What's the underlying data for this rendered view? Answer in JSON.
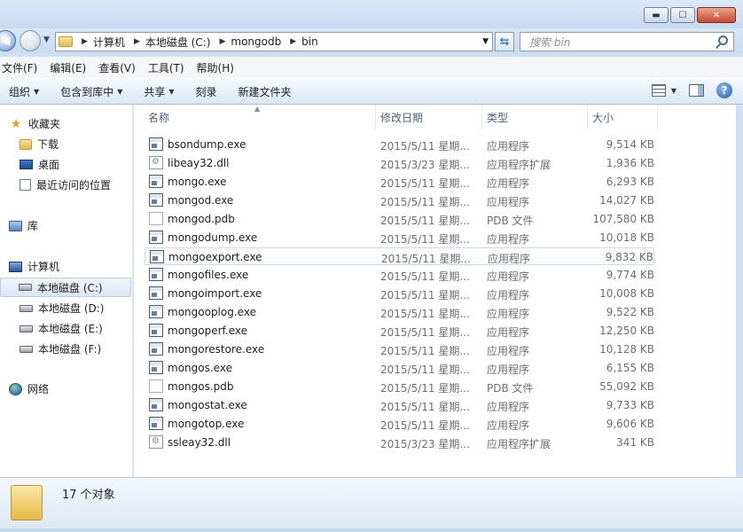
{
  "window": {
    "controls": {
      "minimize": "▬",
      "maximize": "☐",
      "close": "✕"
    }
  },
  "address": {
    "crumbs": [
      "计算机",
      "本地磁盘 (C:)",
      "mongodb",
      "bin"
    ],
    "search_placeholder": "搜索 bin"
  },
  "menu": [
    "文件(F)",
    "编辑(E)",
    "查看(V)",
    "工具(T)",
    "帮助(H)"
  ],
  "commands": [
    "组织",
    "包含到库中",
    "共享",
    "刻录",
    "新建文件夹"
  ],
  "sidebar": {
    "favorites": "收藏夹",
    "fav_items": [
      "下载",
      "桌面",
      "最近访问的位置"
    ],
    "library": "库",
    "computer": "计算机",
    "drives": [
      "本地磁盘 (C:)",
      "本地磁盘 (D:)",
      "本地磁盘 (E:)",
      "本地磁盘 (F:)"
    ],
    "network": "网络"
  },
  "columns": {
    "name": "名称",
    "date": "修改日期",
    "type": "类型",
    "size": "大小"
  },
  "files": [
    {
      "name": "bsondump.exe",
      "date": "2015/5/11 星期...",
      "type": "应用程序",
      "size": "9,514 KB",
      "icon": "exe-icon"
    },
    {
      "name": "libeay32.dll",
      "date": "2015/3/23 星期...",
      "type": "应用程序扩展",
      "size": "1,936 KB",
      "icon": "dll-icon"
    },
    {
      "name": "mongo.exe",
      "date": "2015/5/11 星期...",
      "type": "应用程序",
      "size": "6,293 KB",
      "icon": "exe-icon"
    },
    {
      "name": "mongod.exe",
      "date": "2015/5/11 星期...",
      "type": "应用程序",
      "size": "14,027 KB",
      "icon": "exe-icon"
    },
    {
      "name": "mongod.pdb",
      "date": "2015/5/11 星期...",
      "type": "PDB 文件",
      "size": "107,580 KB",
      "icon": "pdb-icon"
    },
    {
      "name": "mongodump.exe",
      "date": "2015/5/11 星期...",
      "type": "应用程序",
      "size": "10,018 KB",
      "icon": "exe-icon"
    },
    {
      "name": "mongoexport.exe",
      "date": "2015/5/11 星期...",
      "type": "应用程序",
      "size": "9,832 KB",
      "icon": "exe-icon"
    },
    {
      "name": "mongofiles.exe",
      "date": "2015/5/11 星期...",
      "type": "应用程序",
      "size": "9,774 KB",
      "icon": "exe-icon"
    },
    {
      "name": "mongoimport.exe",
      "date": "2015/5/11 星期...",
      "type": "应用程序",
      "size": "10,008 KB",
      "icon": "exe-icon"
    },
    {
      "name": "mongooplog.exe",
      "date": "2015/5/11 星期...",
      "type": "应用程序",
      "size": "9,522 KB",
      "icon": "exe-icon"
    },
    {
      "name": "mongoperf.exe",
      "date": "2015/5/11 星期...",
      "type": "应用程序",
      "size": "12,250 KB",
      "icon": "exe-icon"
    },
    {
      "name": "mongorestore.exe",
      "date": "2015/5/11 星期...",
      "type": "应用程序",
      "size": "10,128 KB",
      "icon": "exe-icon"
    },
    {
      "name": "mongos.exe",
      "date": "2015/5/11 星期...",
      "type": "应用程序",
      "size": "6,155 KB",
      "icon": "exe-icon"
    },
    {
      "name": "mongos.pdb",
      "date": "2015/5/11 星期...",
      "type": "PDB 文件",
      "size": "55,092 KB",
      "icon": "pdb-icon"
    },
    {
      "name": "mongostat.exe",
      "date": "2015/5/11 星期...",
      "type": "应用程序",
      "size": "9,733 KB",
      "icon": "exe-icon"
    },
    {
      "name": "mongotop.exe",
      "date": "2015/5/11 星期...",
      "type": "应用程序",
      "size": "9,606 KB",
      "icon": "exe-icon"
    },
    {
      "name": "ssleay32.dll",
      "date": "2015/3/23 星期...",
      "type": "应用程序扩展",
      "size": "341 KB",
      "icon": "dll-icon"
    }
  ],
  "status": {
    "count": "17 个对象"
  },
  "colors": {
    "accent": "#3f7fc9",
    "titlebar": "#c6d9ef",
    "hover": "#c7dcf2"
  }
}
